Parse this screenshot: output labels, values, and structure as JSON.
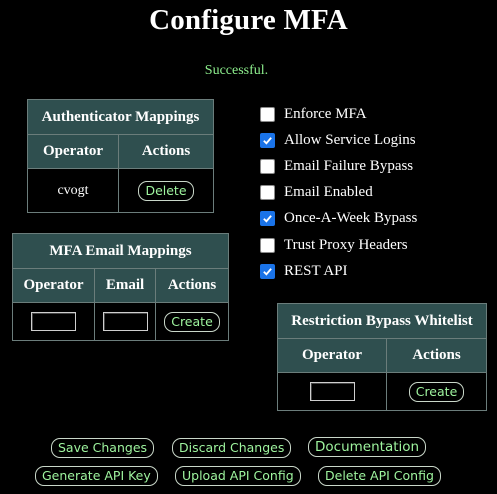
{
  "page": {
    "title": "Configure MFA",
    "status": "Successful."
  },
  "authenticator_mappings": {
    "title": "Authenticator Mappings",
    "columns": [
      "Operator",
      "Actions"
    ],
    "rows": [
      {
        "operator": "cvogt",
        "action_label": "Delete"
      }
    ]
  },
  "mfa_email_mappings": {
    "title": "MFA Email Mappings",
    "columns": [
      "Operator",
      "Email",
      "Actions"
    ],
    "new_row": {
      "operator_value": "",
      "email_value": "",
      "action_label": "Create"
    }
  },
  "restriction_bypass_whitelist": {
    "title": "Restriction Bypass Whitelist",
    "columns": [
      "Operator",
      "Actions"
    ],
    "new_row": {
      "operator_value": "",
      "action_label": "Create"
    }
  },
  "options": [
    {
      "label": "Enforce MFA",
      "checked": false
    },
    {
      "label": "Allow Service Logins",
      "checked": true
    },
    {
      "label": "Email Failure Bypass",
      "checked": false
    },
    {
      "label": "Email Enabled",
      "checked": false
    },
    {
      "label": "Once-A-Week Bypass",
      "checked": true
    },
    {
      "label": "Trust Proxy Headers",
      "checked": false
    },
    {
      "label": "REST API",
      "checked": true
    }
  ],
  "actions": {
    "save": "Save Changes",
    "discard": "Discard Changes",
    "documentation": "Documentation",
    "generate_api_key": "Generate API Key",
    "upload_api_config": "Upload API Config",
    "delete_api_config": "Delete API Config"
  },
  "colors": {
    "header_bg": "#2f4f4f",
    "status_text": "#8ef08e",
    "button_text": "#9ff59f",
    "checkbox_checked": "#1a73e8"
  }
}
